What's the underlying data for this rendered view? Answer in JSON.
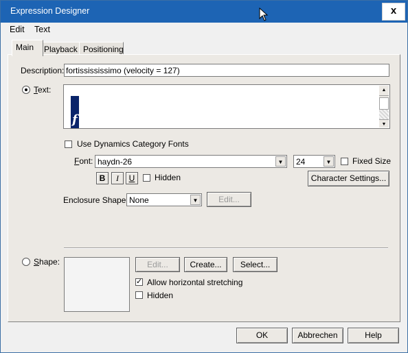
{
  "window": {
    "title": "Expression Designer",
    "close_symbol": "x"
  },
  "menu": {
    "items": [
      "Edit",
      "Text"
    ]
  },
  "tabs": [
    {
      "label": "Main",
      "active": true
    },
    {
      "label": "Playback",
      "active": false
    },
    {
      "label": "Positioning",
      "active": false
    }
  ],
  "description": {
    "label": "Description:",
    "value": "fortissississimo (velocity = 127)"
  },
  "text_option": {
    "label": "Text:",
    "selected": true,
    "preview_glyph": "f"
  },
  "dynamics_fonts": {
    "label": "Use Dynamics Category Fonts",
    "checked": false
  },
  "font": {
    "label": "Font:",
    "name": "haydn-26",
    "size": "24",
    "fixed_size_label": "Fixed Size",
    "fixed_size_checked": false,
    "bold": "B",
    "italic": "I",
    "underline": "U",
    "hidden_label": "Hidden",
    "hidden_checked": false,
    "character_settings": "Character Settings..."
  },
  "enclosure": {
    "label": "Enclosure Shape:",
    "value": "None",
    "edit": "Edit..."
  },
  "shape_option": {
    "label": "Shape:",
    "selected": false,
    "edit": "Edit...",
    "create": "Create...",
    "select": "Select...",
    "stretch_label": "Allow horizontal stretching",
    "stretch_checked": true,
    "hidden_label": "Hidden",
    "hidden_checked": false
  },
  "footer": {
    "ok": "OK",
    "cancel": "Abbrechen",
    "help": "Help"
  },
  "colors": {
    "titlebar": "#1d64b4",
    "preview_bar": "#0a246a"
  }
}
